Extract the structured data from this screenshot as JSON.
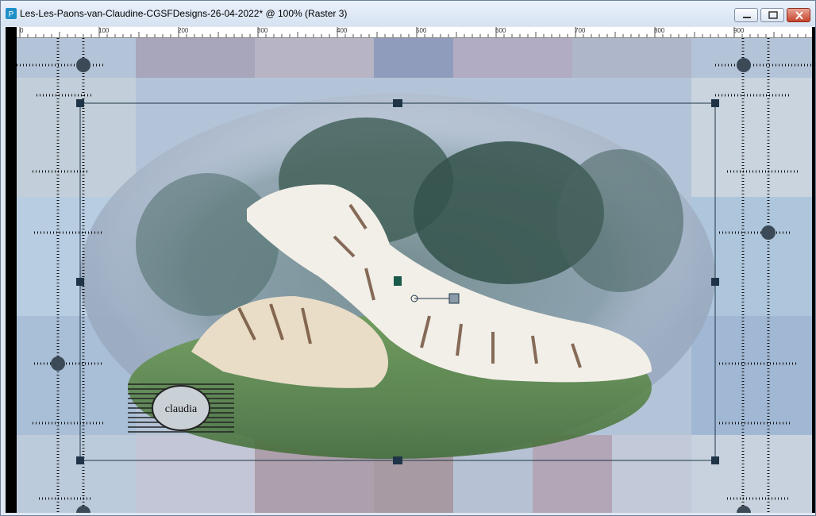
{
  "window": {
    "title": "Les-Les-Paons-van-Claudine-CGSFDesigns-26-04-2022* @ 100% (Raster 3)",
    "app_icon": "paint-shop-pro-icon",
    "controls": [
      "minimize-icon",
      "maximize-icon",
      "close-icon"
    ]
  },
  "ruler": {
    "labels": [
      "0",
      "100",
      "200",
      "300",
      "400",
      "500",
      "600",
      "700",
      "800",
      "900"
    ]
  },
  "watermark": {
    "text": "claudia"
  },
  "colors": {
    "accent": "#1f3547",
    "close": "#c7432c"
  }
}
